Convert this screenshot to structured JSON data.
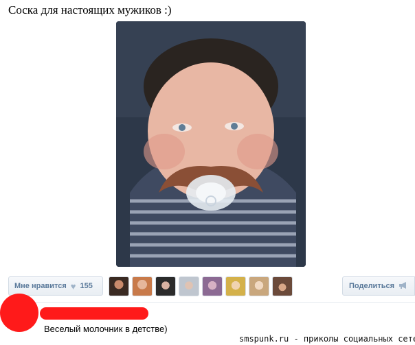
{
  "post": {
    "title": "Соска для настоящих мужиков :)"
  },
  "actions": {
    "like_label": "Мне нравится",
    "like_icon": "heart-icon",
    "like_count": "155",
    "share_label": "Поделиться",
    "share_icon": "megaphone-icon"
  },
  "likers_count_shown": 8,
  "comment": {
    "text": "Веселый молочник в детстве)"
  },
  "watermark": "smspunk.ru - приколы социальных сетей",
  "colors": {
    "accent": "#5b7a9b",
    "redaction": "#ff1a1a"
  }
}
